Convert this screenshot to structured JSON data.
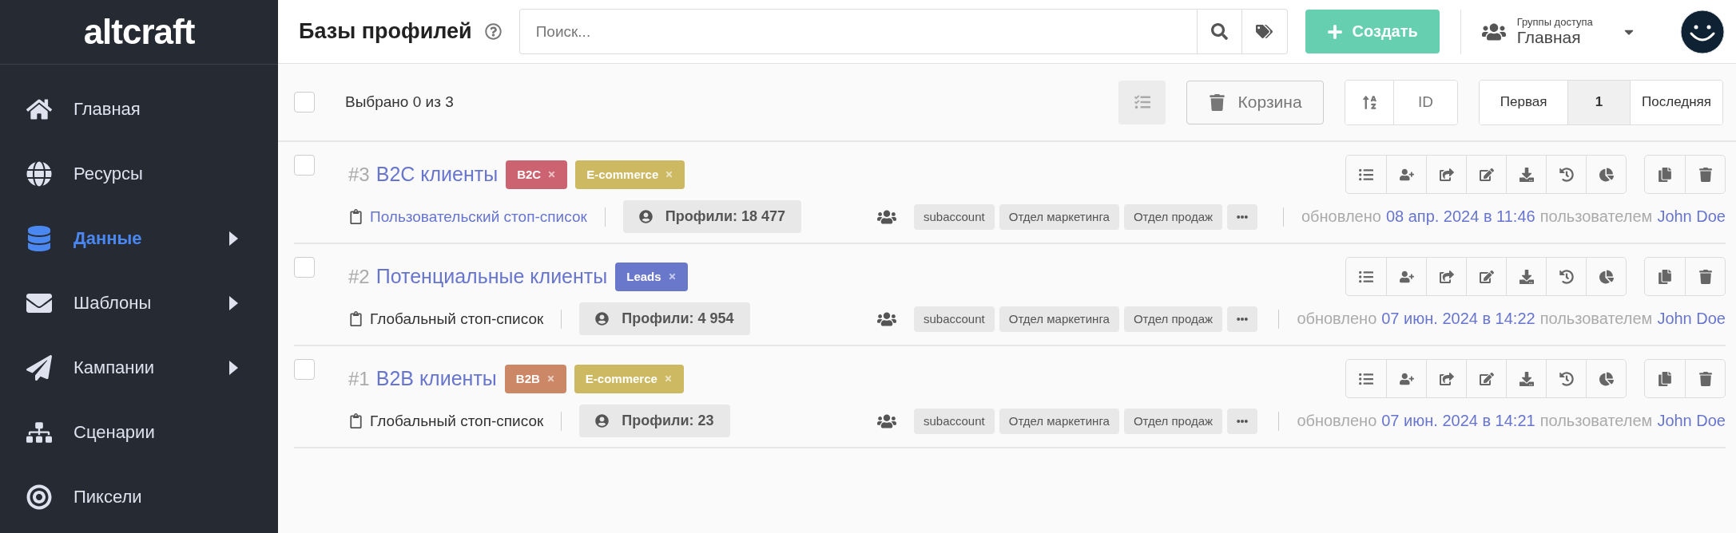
{
  "sidebar": {
    "logo": "altcraft",
    "items": [
      {
        "label": "Главная",
        "selected": false,
        "has_submenu": false
      },
      {
        "label": "Ресурсы",
        "selected": false,
        "has_submenu": false
      },
      {
        "label": "Данные",
        "selected": true,
        "has_submenu": true
      },
      {
        "label": "Шаблоны",
        "selected": false,
        "has_submenu": true
      },
      {
        "label": "Кампании",
        "selected": false,
        "has_submenu": true
      },
      {
        "label": "Сценарии",
        "selected": false,
        "has_submenu": false
      },
      {
        "label": "Пиксели",
        "selected": false,
        "has_submenu": false
      }
    ]
  },
  "header": {
    "title": "Базы профилей",
    "search": {
      "placeholder": "Поиск..."
    },
    "create_button": "Создать",
    "access_group": {
      "label": "Группы доступа",
      "value": "Главная"
    }
  },
  "toolbar": {
    "select_all_checked": false,
    "selection": "Выбрано 0 из 3",
    "trash_button": "Корзина",
    "sort_field": "ID",
    "pagination": [
      {
        "label": "Первая",
        "selected": false
      },
      {
        "label": "1",
        "selected": true
      },
      {
        "label": "Последняя",
        "selected": false
      }
    ]
  },
  "databases": [
    {
      "checked": false,
      "number": "#3",
      "title": "B2C клиенты",
      "tags": [
        {
          "label": "B2C",
          "color": "#cc6370"
        },
        {
          "label": "E-commerce",
          "color": "#cdb961"
        }
      ],
      "stoplist": {
        "text": "Пользовательский стоп-список",
        "kind": "custom"
      },
      "profiles": "Профили: 18 477",
      "groups": [
        "subaccount",
        "Отдел маркетинга",
        "Отдел продаж"
      ],
      "updated_label": "обновлено",
      "updated_date": "08 апр. 2024 в 11:46",
      "updated_by_label": "пользователем",
      "user": "John Doe"
    },
    {
      "checked": false,
      "number": "#2",
      "title": "Потенциальные клиенты",
      "tags": [
        {
          "label": "Leads",
          "color": "#6a78cc"
        }
      ],
      "stoplist": {
        "text": "Глобальный стоп-список",
        "kind": "global"
      },
      "profiles": "Профили: 4 954",
      "groups": [
        "subaccount",
        "Отдел маркетинга",
        "Отдел продаж"
      ],
      "updated_label": "обновлено",
      "updated_date": "07 июн. 2024 в 14:22",
      "updated_by_label": "пользователем",
      "user": "John Doe"
    },
    {
      "checked": false,
      "number": "#1",
      "title": "B2B клиенты",
      "tags": [
        {
          "label": "B2B",
          "color": "#cc8866"
        },
        {
          "label": "E-commerce",
          "color": "#cdb961"
        }
      ],
      "stoplist": {
        "text": "Глобальный стоп-список",
        "kind": "global"
      },
      "profiles": "Профили: 23",
      "groups": [
        "subaccount",
        "Отдел маркетинга",
        "Отдел продаж"
      ],
      "updated_label": "обновлено",
      "updated_date": "07 июн. 2024 в 14:21",
      "updated_by_label": "пользователем",
      "user": "John Doe"
    }
  ]
}
